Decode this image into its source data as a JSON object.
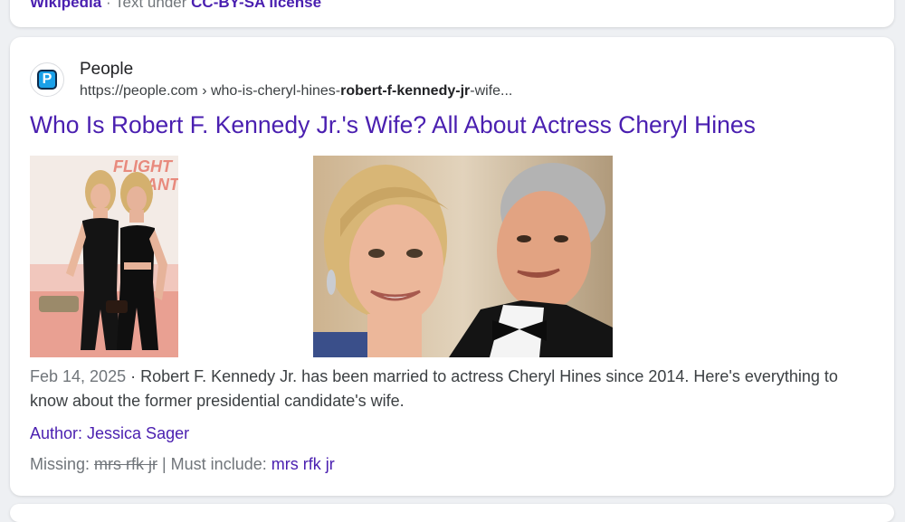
{
  "previous_result": {
    "source_link": "Wikipedia",
    "license_prefix": "· Text under",
    "license_link": "CC-BY-SA license"
  },
  "result": {
    "site_name": "People",
    "favicon_letter": "P",
    "url_base": "https://people.com",
    "url_sep": " › ",
    "url_pre": "who-is-cheryl-hines-",
    "url_bold": "robert-f-kennedy-jr",
    "url_post": "-wife...",
    "title": "Who Is Robert F. Kennedy Jr.'s Wife? All About Actress Cheryl Hines",
    "image1_sign_text": "FLIGHT ANT",
    "date": "Feb 14, 2025",
    "snippet": " · Robert F. Kennedy Jr. has been married to actress Cheryl Hines since 2014. Here's everything to know about the former presidential candidate's wife.",
    "author_label": "Author: Jessica Sager",
    "missing_label": "Missing: ",
    "missing_terms": "mrs rfk jr",
    "include_label": " | Must include: ",
    "include_terms": "mrs rfk jr"
  },
  "colors": {
    "link": "#4a1fb0",
    "text": "#3c4043",
    "muted": "#70757a",
    "background": "#eef0f3",
    "card": "#ffffff"
  },
  "icons": [
    "people-favicon-icon"
  ]
}
